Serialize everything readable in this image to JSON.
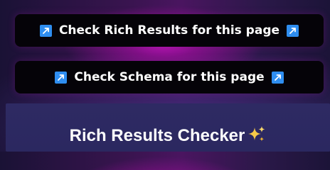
{
  "buttons": {
    "rich_results": {
      "label": "Check Rich Results for this page",
      "icon": "arrow-up-right-icon"
    },
    "schema": {
      "label": "Check Schema for this page",
      "icon": "arrow-up-right-icon"
    }
  },
  "checker": {
    "title": "Rich Results Checker",
    "title_icon": "sparkles-icon"
  },
  "colors": {
    "button_bg": "#050308",
    "icon_bg": "#2f8ef0",
    "panel_bg": "#2e2a63",
    "glow": "#be14b9",
    "text": "#ffffff"
  }
}
